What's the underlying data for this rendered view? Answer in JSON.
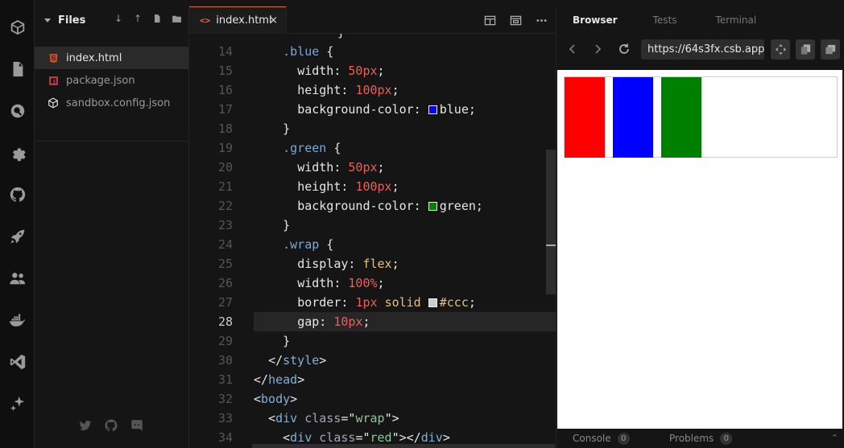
{
  "activity_bar": {
    "icons": [
      "box-icon",
      "file-icon",
      "search-icon",
      "gear-icon",
      "github-icon",
      "rocket-icon",
      "users-icon",
      "docker-icon",
      "vscode-icon",
      "sparkle-icon"
    ]
  },
  "sidebar": {
    "title": "Files",
    "files": [
      {
        "name": "index.html",
        "icon": "html5-icon",
        "active": true
      },
      {
        "name": "package.json",
        "icon": "npm-icon",
        "active": false
      },
      {
        "name": "sandbox.config.json",
        "icon": "cube-icon",
        "active": false
      }
    ],
    "social": [
      "twitter-icon",
      "github-icon",
      "discord-icon"
    ]
  },
  "editor": {
    "tab": {
      "icon": "<>",
      "label": "index.html",
      "close": "×"
    },
    "current_line": 28,
    "lines": [
      {
        "n": "14",
        "indent": "    ",
        "parts": [
          [
            "sel",
            ".blue"
          ],
          [
            "",
            " {"
          ]
        ]
      },
      {
        "n": "15",
        "indent": "      ",
        "parts": [
          [
            "",
            "width: "
          ],
          [
            "num",
            "50px"
          ],
          [
            "",
            ";"
          ]
        ]
      },
      {
        "n": "16",
        "indent": "      ",
        "parts": [
          [
            "",
            "height: "
          ],
          [
            "num",
            "100px"
          ],
          [
            "",
            ";"
          ]
        ]
      },
      {
        "n": "17",
        "indent": "      ",
        "parts": [
          [
            "",
            "background-color: "
          ],
          [
            "swatch:#0000ff",
            ""
          ],
          [
            "",
            "blue;"
          ]
        ]
      },
      {
        "n": "18",
        "indent": "    ",
        "parts": [
          [
            "",
            "}"
          ]
        ]
      },
      {
        "n": "19",
        "indent": "    ",
        "parts": [
          [
            "sel",
            ".green"
          ],
          [
            "",
            " {"
          ]
        ]
      },
      {
        "n": "20",
        "indent": "      ",
        "parts": [
          [
            "",
            "width: "
          ],
          [
            "num",
            "50px"
          ],
          [
            "",
            ";"
          ]
        ]
      },
      {
        "n": "21",
        "indent": "      ",
        "parts": [
          [
            "",
            "height: "
          ],
          [
            "num",
            "100px"
          ],
          [
            "",
            ";"
          ]
        ]
      },
      {
        "n": "22",
        "indent": "      ",
        "parts": [
          [
            "",
            "background-color: "
          ],
          [
            "swatch:#008000",
            ""
          ],
          [
            "",
            "green;"
          ]
        ]
      },
      {
        "n": "23",
        "indent": "    ",
        "parts": [
          [
            "",
            "}"
          ]
        ]
      },
      {
        "n": "24",
        "indent": "    ",
        "parts": [
          [
            "sel",
            ".wrap"
          ],
          [
            "",
            " {"
          ]
        ]
      },
      {
        "n": "25",
        "indent": "      ",
        "parts": [
          [
            "",
            "display: "
          ],
          [
            "kw",
            "flex"
          ],
          [
            "",
            ";"
          ]
        ]
      },
      {
        "n": "26",
        "indent": "      ",
        "parts": [
          [
            "",
            "width: "
          ],
          [
            "num",
            "100%"
          ],
          [
            "",
            ";"
          ]
        ]
      },
      {
        "n": "27",
        "indent": "      ",
        "parts": [
          [
            "",
            "border: "
          ],
          [
            "num",
            "1px"
          ],
          [
            "",
            " "
          ],
          [
            "kw",
            "solid"
          ],
          [
            "",
            " "
          ],
          [
            "swatch:#cccccc",
            ""
          ],
          [
            "kw",
            "#ccc"
          ],
          [
            "",
            ";"
          ]
        ]
      },
      {
        "n": "28",
        "indent": "      ",
        "parts": [
          [
            "",
            "gap: "
          ],
          [
            "num",
            "10px"
          ],
          [
            "",
            ";"
          ]
        ]
      },
      {
        "n": "29",
        "indent": "    ",
        "parts": [
          [
            "",
            "}"
          ]
        ]
      },
      {
        "n": "30",
        "indent": "  ",
        "parts": [
          [
            "",
            "</"
          ],
          [
            "tag",
            "style"
          ],
          [
            "",
            ">"
          ]
        ]
      },
      {
        "n": "31",
        "indent": "",
        "parts": [
          [
            "",
            "</"
          ],
          [
            "tag",
            "head"
          ],
          [
            "",
            ">"
          ]
        ]
      },
      {
        "n": "32",
        "indent": "",
        "parts": [
          [
            "",
            "<"
          ],
          [
            "tag",
            "body"
          ],
          [
            "",
            ">"
          ]
        ]
      },
      {
        "n": "33",
        "indent": "  ",
        "parts": [
          [
            "",
            "<"
          ],
          [
            "tag",
            "div"
          ],
          [
            "",
            " "
          ],
          [
            "attr",
            "class"
          ],
          [
            "",
            "=\""
          ],
          [
            "str",
            "wrap"
          ],
          [
            "",
            "\">"
          ]
        ]
      },
      {
        "n": "34",
        "indent": "    ",
        "parts": [
          [
            "",
            "<"
          ],
          [
            "tag",
            "div"
          ],
          [
            "",
            " "
          ],
          [
            "attr",
            "class"
          ],
          [
            "",
            "=\""
          ],
          [
            "str",
            "red"
          ],
          [
            "",
            "\"></"
          ],
          [
            "tag",
            "div"
          ],
          [
            "",
            ">"
          ]
        ]
      }
    ],
    "partial_top": "}"
  },
  "browser": {
    "tabs": [
      "Browser",
      "Tests",
      "Terminal"
    ],
    "active_tab": "Browser",
    "url": "https://64s3fx.csb.app/",
    "preview_boxes": [
      {
        "name": "red",
        "color": "#ff0000"
      },
      {
        "name": "blue",
        "color": "#0000ff"
      },
      {
        "name": "green",
        "color": "#008000"
      }
    ],
    "footer": {
      "console_label": "Console",
      "console_count": "0",
      "problems_label": "Problems",
      "problems_count": "0"
    }
  },
  "colors": {
    "accent": "#e56f3a",
    "background": "#151515"
  }
}
